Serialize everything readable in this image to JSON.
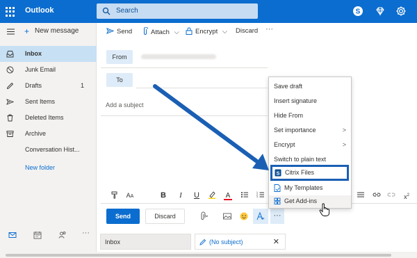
{
  "app": {
    "name": "Outlook"
  },
  "search": {
    "placeholder": "Search"
  },
  "topbar": {
    "icons": [
      "skype-icon",
      "diamond-icon",
      "gear-icon"
    ]
  },
  "sidebar": {
    "new_message": "New message",
    "items": [
      {
        "label": "Inbox",
        "count": "",
        "icon": "inbox-icon",
        "selected": true
      },
      {
        "label": "Junk Email",
        "count": "",
        "icon": "block-icon"
      },
      {
        "label": "Drafts",
        "count": "1",
        "icon": "pencil-icon"
      },
      {
        "label": "Sent Items",
        "count": "",
        "icon": "send-icon"
      },
      {
        "label": "Deleted Items",
        "count": "",
        "icon": "trash-icon"
      },
      {
        "label": "Archive",
        "count": "",
        "icon": "archive-icon"
      },
      {
        "label": "Conversation Hist...",
        "count": "",
        "icon": ""
      },
      {
        "label": "New folder",
        "count": "",
        "icon": ""
      }
    ],
    "footer_icons": [
      "mail-icon",
      "calendar-icon",
      "people-icon",
      "more-icon"
    ]
  },
  "toolbar": {
    "send": "Send",
    "attach": "Attach",
    "encrypt": "Encrypt",
    "discard": "Discard",
    "more": "···"
  },
  "compose": {
    "from_label": "From",
    "to_label": "To",
    "subject_placeholder": "Add a subject",
    "send": "Send",
    "discard": "Discard",
    "more": "···"
  },
  "menu": {
    "items": [
      {
        "label": "Save draft"
      },
      {
        "label": "Insert signature"
      },
      {
        "label": "Hide From"
      },
      {
        "label": "Set importance",
        "submenu": true
      },
      {
        "label": "Encrypt",
        "submenu": true
      },
      {
        "label": "Switch to plain text"
      },
      {
        "label": "Citrix Files",
        "highlighted": true
      },
      {
        "label": "My Templates"
      },
      {
        "label": "Get Add-ins",
        "hover": true
      }
    ]
  },
  "tabs": {
    "inbox": "Inbox",
    "draft": "(No subject)"
  },
  "colors": {
    "brand": "#0b6dcf",
    "arrow": "#1a5fb4",
    "selected": "#c7e0f4"
  }
}
